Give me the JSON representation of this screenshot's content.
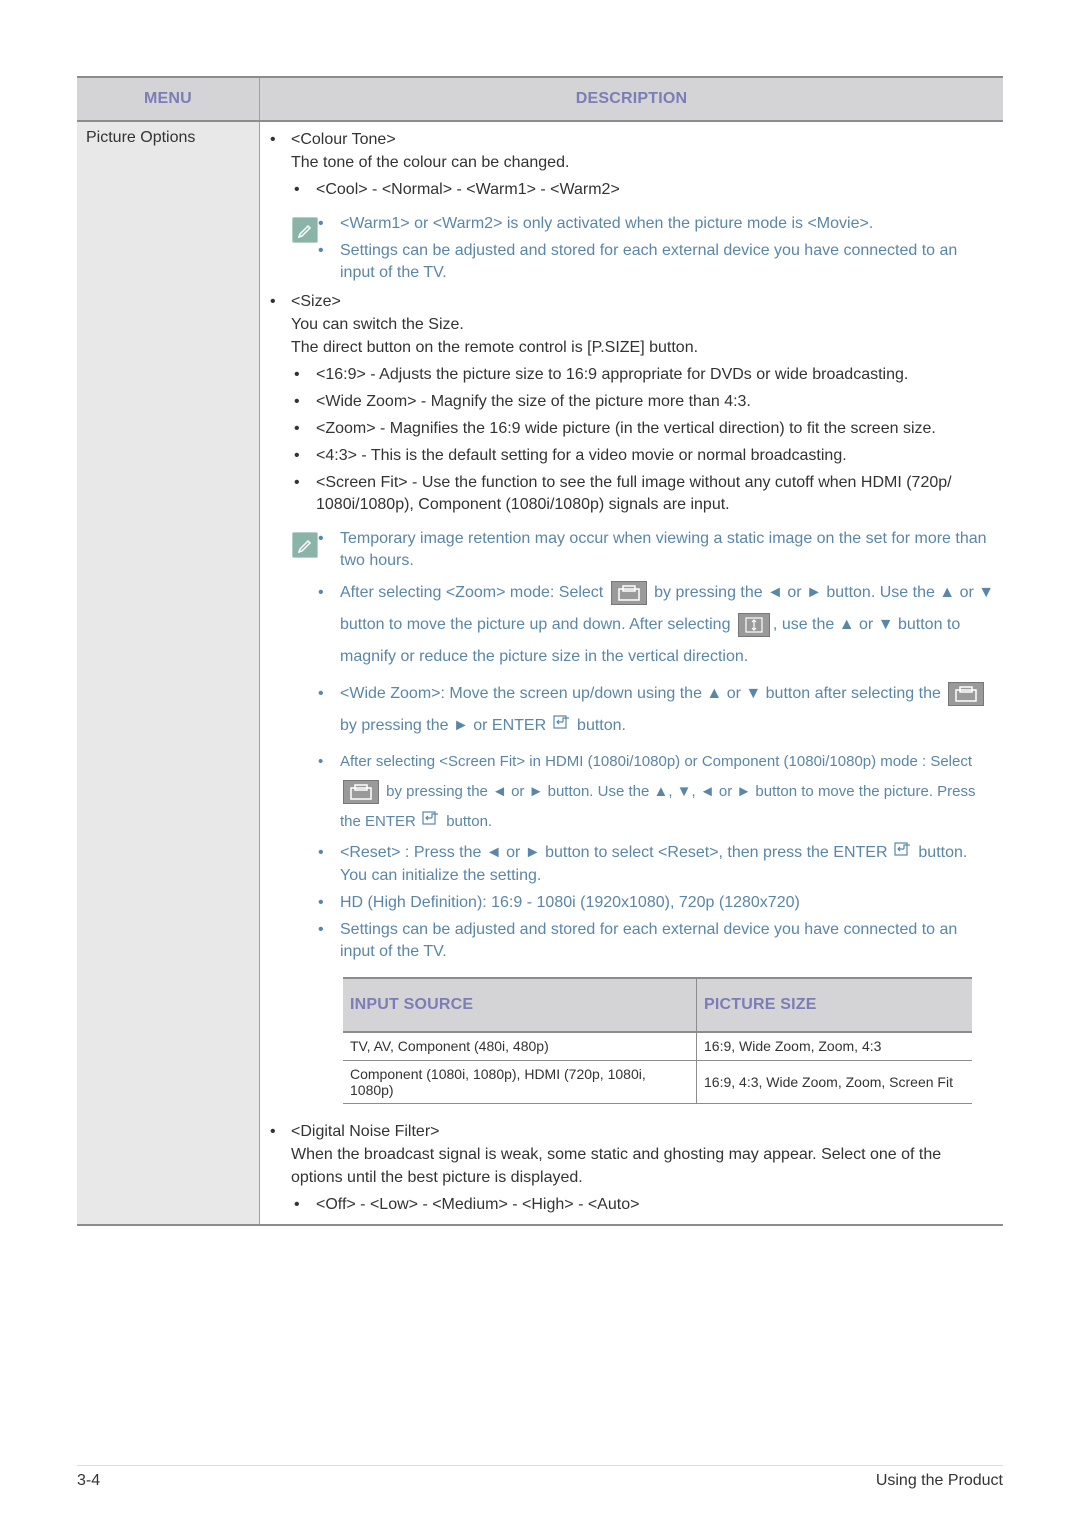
{
  "header": {
    "menu": "MENU",
    "description": "DESCRIPTION"
  },
  "menu_item": "Picture Options",
  "colour_tone": {
    "title": "<Colour Tone>",
    "desc": "The tone of the colour can be changed.",
    "options": "<Cool> - <Normal> - <Warm1> - <Warm2>",
    "notes": [
      "<Warm1> or <Warm2> is only activated when the picture mode is <Movie>.",
      "Settings can be adjusted and stored for each external device you have connected to an input of the TV."
    ]
  },
  "size": {
    "title": "<Size>",
    "desc1": "You can switch the Size.",
    "desc2": "The direct button on the remote control is [P.SIZE] button.",
    "options": [
      "<16:9> - Adjusts the picture size to 16:9 appropriate for DVDs or wide broadcasting.",
      "<Wide Zoom> - Magnify the size of the picture more than 4:3.",
      "<Zoom> - Magnifies the 16:9 wide picture (in the vertical direction) to fit the screen size.",
      "<4:3> - This is the default setting for a video movie or normal broadcasting.",
      "<Screen Fit> - Use the function to see the full image without any cutoff when HDMI (720p/ 1080i/1080p), Component (1080i/1080p) signals are input."
    ],
    "notes": {
      "n1": "Temporary image retention may occur when viewing a static image on the set for more than two hours.",
      "n2a": "After selecting <Zoom> mode: Select",
      "n2b": "by pressing the ◄ or ► button. Use the ▲ or ▼ button to move the picture up and down. After selecting",
      "n2c": ", use the ▲ or ▼ button to magnify or reduce the picture size in the vertical direction.",
      "n3a": "<Wide Zoom>: Move the screen up/down using the ▲ or ▼ button after selecting the",
      "n3b": "by pressing the ► or ENTER",
      "n3c": "button.",
      "n4a": "After selecting <Screen Fit> in HDMI (1080i/1080p) or Component (1080i/1080p) mode : Select",
      "n4b": "by pressing the ◄ or ► button. Use the ▲, ▼, ◄ or ► button to move the picture. Press the ENTER",
      "n4c": "button.",
      "n5a": "<Reset> : Press the ◄ or ► button to select <Reset>, then press the ENTER",
      "n5b": "button. You can initialize the setting.",
      "n6": "HD (High Definition): 16:9 - 1080i (1920x1080), 720p (1280x720)",
      "n7": "Settings can be adjusted and stored for each external device you have connected to an input of the TV."
    },
    "table": {
      "headers": [
        "Input  Source",
        "Picture Size"
      ],
      "rows": [
        [
          "TV, AV, Component (480i, 480p)",
          "16:9, Wide Zoom, Zoom, 4:3"
        ],
        [
          "Component (1080i, 1080p), HDMI (720p, 1080i, 1080p)",
          "16:9, 4:3, Wide Zoom, Zoom, Screen Fit"
        ]
      ]
    }
  },
  "dnf": {
    "title": "<Digital Noise Filter>",
    "desc": "When the broadcast signal is weak, some static and ghosting may appear. Select one of the options until the best picture is displayed.",
    "options": "<Off> - <Low> - <Medium> - <High> - <Auto>"
  },
  "footer": {
    "page": "3-4",
    "section": "Using the Product"
  },
  "colors": {
    "header_text": "#7b7db6",
    "note_text": "#5a86a8",
    "header_bg": "#d4d4d6",
    "menu_bg": "#e8e8e8"
  }
}
